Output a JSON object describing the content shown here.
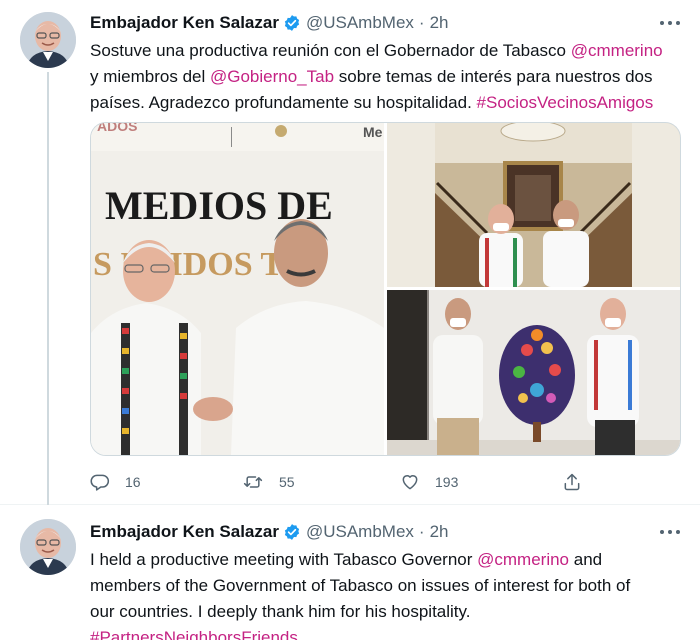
{
  "tweets": [
    {
      "author": {
        "name": "Embajador Ken Salazar",
        "handle": "@USAmbMex",
        "separator": "·",
        "time": "2h"
      },
      "text_lines": [
        {
          "a": "Sostuve una productiva reunión con el Gobernador de Tabasco ",
          "mention": "@cmmerino"
        },
        {
          "a": "y miembros del ",
          "mention": "@Gobierno_Tab",
          "b": " sobre temas de interés para nuestros dos"
        },
        {
          "a": "países. Agradezco profundamente su hospitalidad. ",
          "hashtag": "#SociosVecinosAmigos"
        }
      ],
      "media": {
        "photo_main_sign": {
          "line1": "MEDIOS DE",
          "line2": "S UNIDOS  TA",
          "fragment_left": "ADOS",
          "fragment_right": "Me"
        }
      },
      "actions": {
        "replies": "16",
        "retweets": "55",
        "likes": "193"
      }
    },
    {
      "author": {
        "name": "Embajador Ken Salazar",
        "handle": "@USAmbMex",
        "separator": "·",
        "time": "2h"
      },
      "text_lines": [
        {
          "a": "I held a productive meeting with Tabasco Governor ",
          "mention": "@cmmerino",
          "b": " and"
        },
        {
          "a": "members of the Government of Tabasco on issues of interest for both of"
        },
        {
          "a": "our countries. I deeply thank him for his hospitality."
        },
        {
          "hashtag": "#PartnersNeighborsFriends"
        }
      ]
    }
  ],
  "icons": {
    "verified": "verified-badge-icon",
    "more": "more-options-icon",
    "reply": "reply-icon",
    "retweet": "retweet-icon",
    "like": "heart-icon",
    "share": "share-icon"
  },
  "colors": {
    "accent": "#c42283",
    "verified": "#1d9bf0",
    "secondary_text": "#536471",
    "primary_text": "#0f1419"
  }
}
